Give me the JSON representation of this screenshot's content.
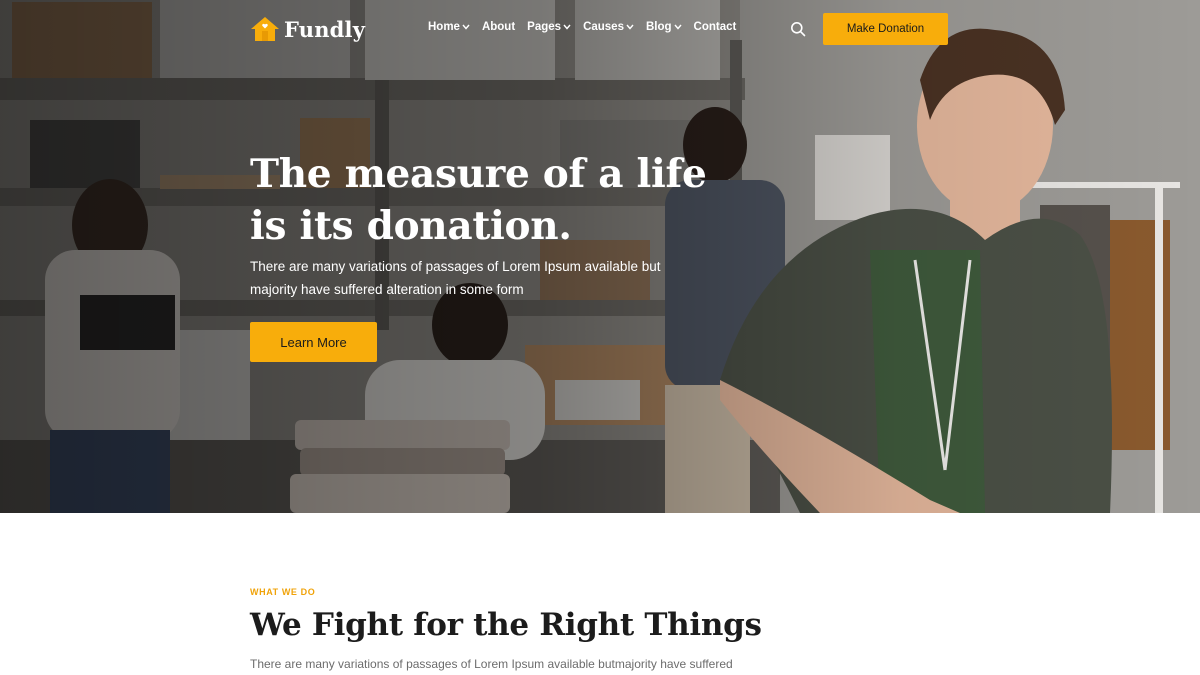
{
  "brand": {
    "name": "Fundly"
  },
  "nav": {
    "items": [
      {
        "label": "Home",
        "has_dropdown": true
      },
      {
        "label": "About",
        "has_dropdown": false
      },
      {
        "label": "Pages",
        "has_dropdown": true
      },
      {
        "label": "Causes",
        "has_dropdown": true
      },
      {
        "label": "Blog",
        "has_dropdown": true
      },
      {
        "label": "Contact",
        "has_dropdown": false
      }
    ],
    "search_icon": "search-icon",
    "donate_label": "Make Donation"
  },
  "hero": {
    "title_line1": "The measure of a life",
    "title_line2": "is its donation.",
    "subtitle": "There are many variations of passages of Lorem Ipsum available but majority have suffered alteration in some form",
    "cta_label": "Learn More"
  },
  "section": {
    "eyebrow": "WHAT WE DO",
    "title": "We Fight for the Right Things",
    "text": "There are many variations of passages of Lorem Ipsum available butmajority have suffered"
  },
  "colors": {
    "accent": "#f8ad0b",
    "eyebrow": "#f0a30a",
    "heading": "#1c1c1c",
    "body_text": "#6c6c6c"
  }
}
